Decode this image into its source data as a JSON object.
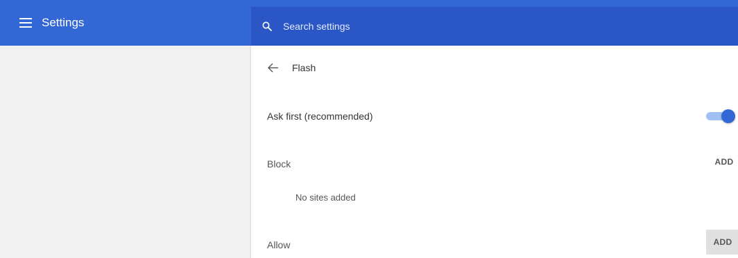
{
  "header": {
    "title": "Settings",
    "menu_icon": "hamburger-menu-icon"
  },
  "search": {
    "placeholder": "Search settings",
    "icon": "search-icon"
  },
  "page": {
    "title": "Flash",
    "back_icon": "arrow-back-icon"
  },
  "ask_first": {
    "label": "Ask first (recommended)",
    "enabled": true
  },
  "block": {
    "label": "Block",
    "add_label": "ADD",
    "empty_text": "No sites added"
  },
  "allow": {
    "label": "Allow",
    "add_label": "ADD"
  },
  "colors": {
    "header_bg": "#3367d6",
    "search_bg": "#2a56c6",
    "toggle_on": "#3367d6"
  }
}
